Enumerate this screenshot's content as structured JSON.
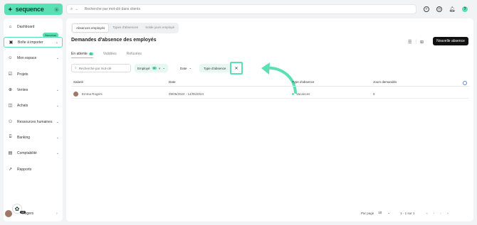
{
  "brand": {
    "name": "sequence",
    "badge": "$"
  },
  "search": {
    "placeholder": "Recherche par mot-clé dans clients"
  },
  "sidebar": {
    "items": [
      {
        "label": "Dashboard",
        "icon": "home-icon"
      },
      {
        "label": "Boîte à importer",
        "icon": "inbox-icon"
      },
      {
        "label": "Mon espace",
        "icon": "user-space-icon"
      },
      {
        "label": "Projets",
        "icon": "check-square-icon"
      },
      {
        "label": "Ventes",
        "icon": "sales-icon"
      },
      {
        "label": "Achats",
        "icon": "bag-icon"
      },
      {
        "label": "Ressources humaines",
        "icon": "people-icon"
      },
      {
        "label": "Banking",
        "icon": "bank-icon"
      },
      {
        "label": "Comptabilité",
        "icon": "ledger-icon"
      },
      {
        "label": "Rapports",
        "icon": "chart-icon"
      }
    ],
    "new_badge": "Nouveau",
    "user_label": "Rogers",
    "fab_count": "12"
  },
  "main": {
    "segments": [
      "Absences employés",
      "Types d'absences",
      "Solde jours employé"
    ],
    "title": "Demandes d'absence des employés",
    "new_button": "Nouvelle absence",
    "subtabs": [
      {
        "label": "En attente",
        "count": "1"
      },
      {
        "label": "Validées"
      },
      {
        "label": "Refusées"
      }
    ],
    "filter_search_placeholder": "Recherche par mot-clé",
    "filter_employee": {
      "label": "Employé",
      "count": "1"
    },
    "filter_date": "Date",
    "filter_type": "Type d'absence",
    "columns": [
      "Salarié",
      "Date",
      "Type d'absence",
      "Jours demandés"
    ],
    "rows": [
      {
        "employee": "Emma Rogers",
        "date": "09/05/2024 - 14/05/2024",
        "type": "Vacances",
        "days": "6"
      }
    ],
    "pagination": {
      "per_page_label": "Par page",
      "per_page": "10",
      "range": "1 - 1 sur 1"
    }
  },
  "colors": {
    "accent": "#5be0b3",
    "dark": "#111111"
  }
}
